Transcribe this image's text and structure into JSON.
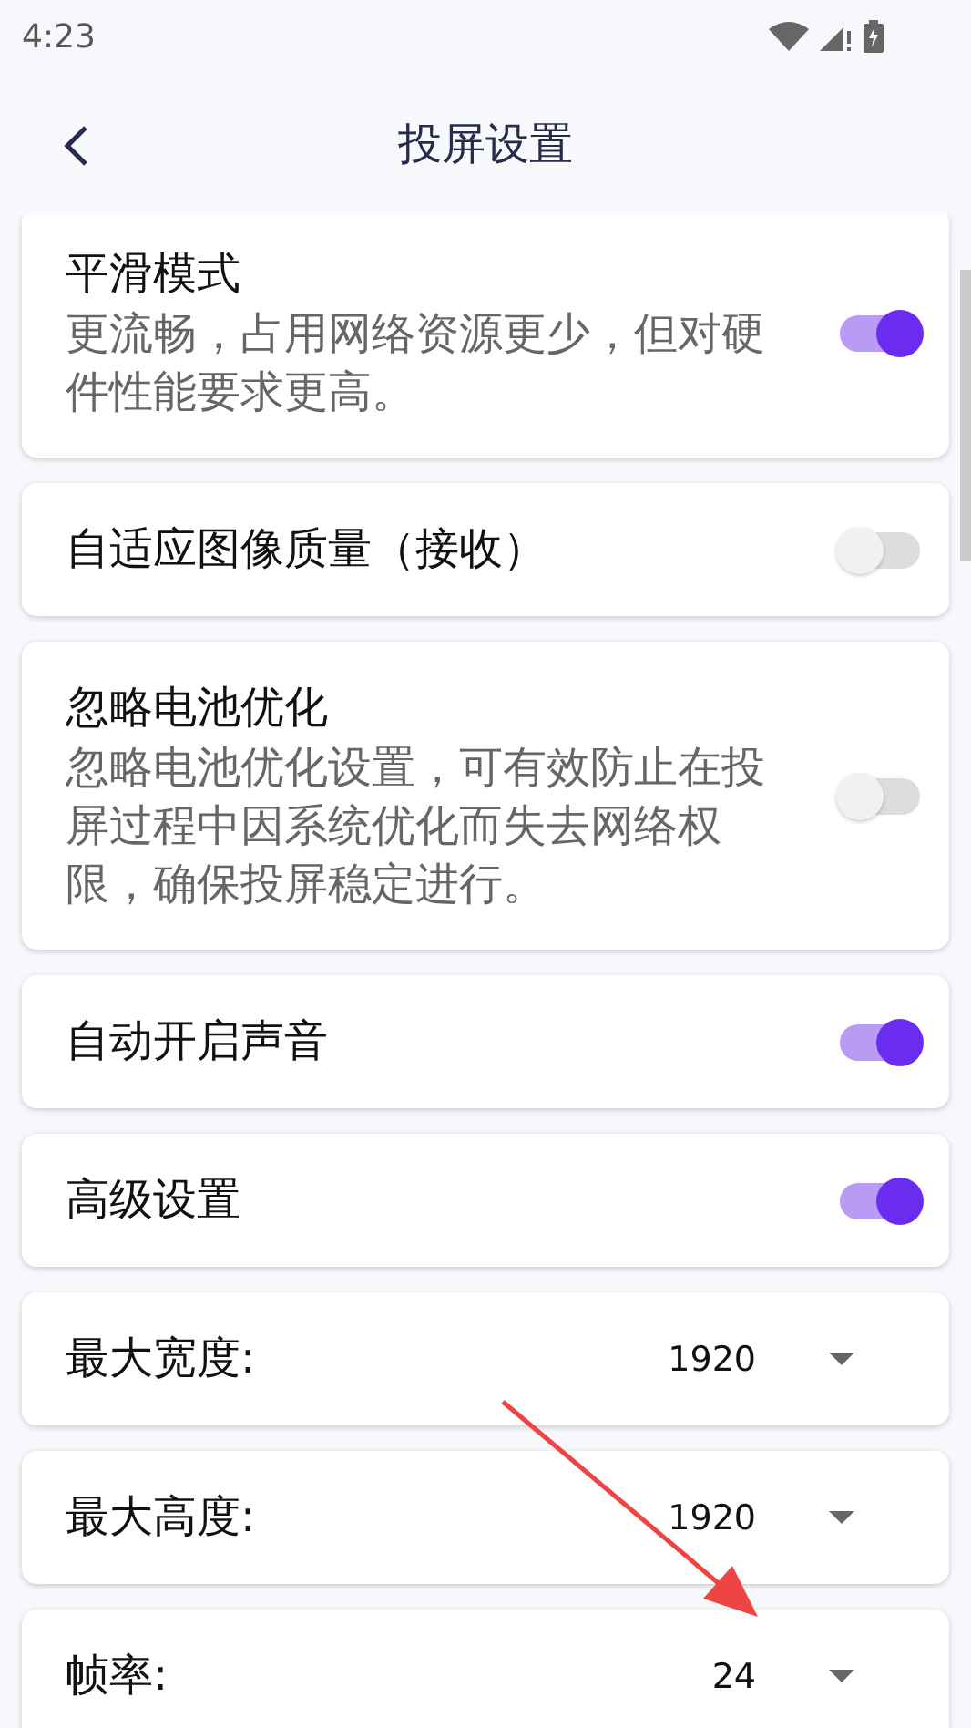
{
  "status_bar": {
    "time": "4:23"
  },
  "header": {
    "title": "投屏设置"
  },
  "settings": [
    {
      "kind": "toggle",
      "title": "平滑模式",
      "description": "更流畅，占用网络资源更少，但对硬件性能要求更高。",
      "on": true
    },
    {
      "kind": "toggle",
      "title": "自适应图像质量（接收）",
      "on": false
    },
    {
      "kind": "toggle",
      "title": "忽略电池优化",
      "description": "忽略电池优化设置，可有效防止在投屏过程中因系统优化而失去网络权限，确保投屏稳定进行。",
      "on": false
    },
    {
      "kind": "toggle",
      "title": "自动开启声音",
      "on": true
    },
    {
      "kind": "toggle",
      "title": "高级设置",
      "on": true
    },
    {
      "kind": "select",
      "title": "最大宽度:",
      "value": "1920"
    },
    {
      "kind": "select",
      "title": "最大高度:",
      "value": "1920"
    },
    {
      "kind": "select",
      "title": "帧率:",
      "value": "24"
    }
  ]
}
